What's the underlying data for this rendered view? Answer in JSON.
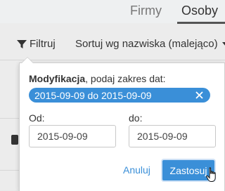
{
  "tabs": [
    {
      "label": "Firmy",
      "active": false
    },
    {
      "label": "Osoby",
      "active": true
    }
  ],
  "toolbar": {
    "filter_label": "Filtruj",
    "filter_icon": "funnel-icon",
    "sort_label": "Sortuj wg nazwiska (malejąco)",
    "sort_icon": "caret-down-icon"
  },
  "filter_popup": {
    "field_name": "Modyfikacja",
    "title_suffix": ", podaj zakres dat:",
    "selected_range": "2015-09-09 do 2015-09-09",
    "from_label": "Od:",
    "from_value": "2015-09-09",
    "to_label": "do:",
    "to_value": "2015-09-09",
    "cancel_label": "Anuluj",
    "apply_label": "Zastosuj"
  },
  "colors": {
    "accent": "#3a8fd8",
    "text": "#333333",
    "background": "#ececec"
  }
}
